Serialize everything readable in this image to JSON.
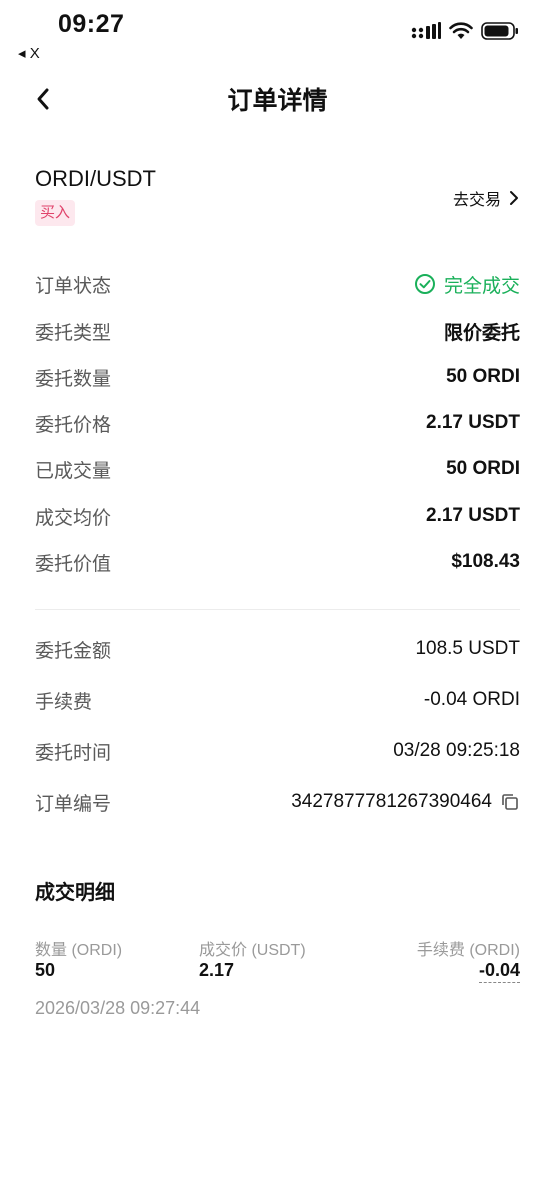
{
  "status_bar": {
    "time": "09:27",
    "back_app": "◂ X",
    "icons": [
      "signal-icon",
      "wifi-icon",
      "battery-icon"
    ]
  },
  "header": {
    "title": "订单详情",
    "back_icon": "chevron-left-icon"
  },
  "pair": {
    "symbol": "ORDI/USDT",
    "side": "买入",
    "trade_link": "去交易"
  },
  "details": [
    {
      "label": "订单状态",
      "value": "完全成交"
    },
    {
      "label": "委托类型",
      "value": "限价委托"
    },
    {
      "label": "委托数量",
      "value": "50 ORDI"
    },
    {
      "label": "委托价格",
      "value": "2.17 USDT"
    },
    {
      "label": "已成交量",
      "value": "50 ORDI"
    },
    {
      "label": "成交均价",
      "value": "2.17 USDT"
    },
    {
      "label": "委托价值",
      "value": "$108.43"
    }
  ],
  "extra": [
    {
      "label": "委托金额",
      "value": "108.5 USDT"
    },
    {
      "label": "手续费",
      "value": "-0.04 ORDI"
    },
    {
      "label": "委托时间",
      "value": "03/28 09:25:18"
    },
    {
      "label": "订单编号",
      "value": "3427877781267390464"
    }
  ],
  "fills": {
    "title": "成交明细",
    "col_qty": "数量 (ORDI)",
    "col_price": "成交价 (USDT)",
    "col_fee": "手续费 (ORDI)",
    "qty": "50",
    "price": "2.17",
    "fee": "-0.04",
    "time": "2026/03/28 09:27:44"
  },
  "colors": {
    "success": "#1ab05a",
    "buy": "#e0426a",
    "buy_bg": "#fde8ee"
  }
}
